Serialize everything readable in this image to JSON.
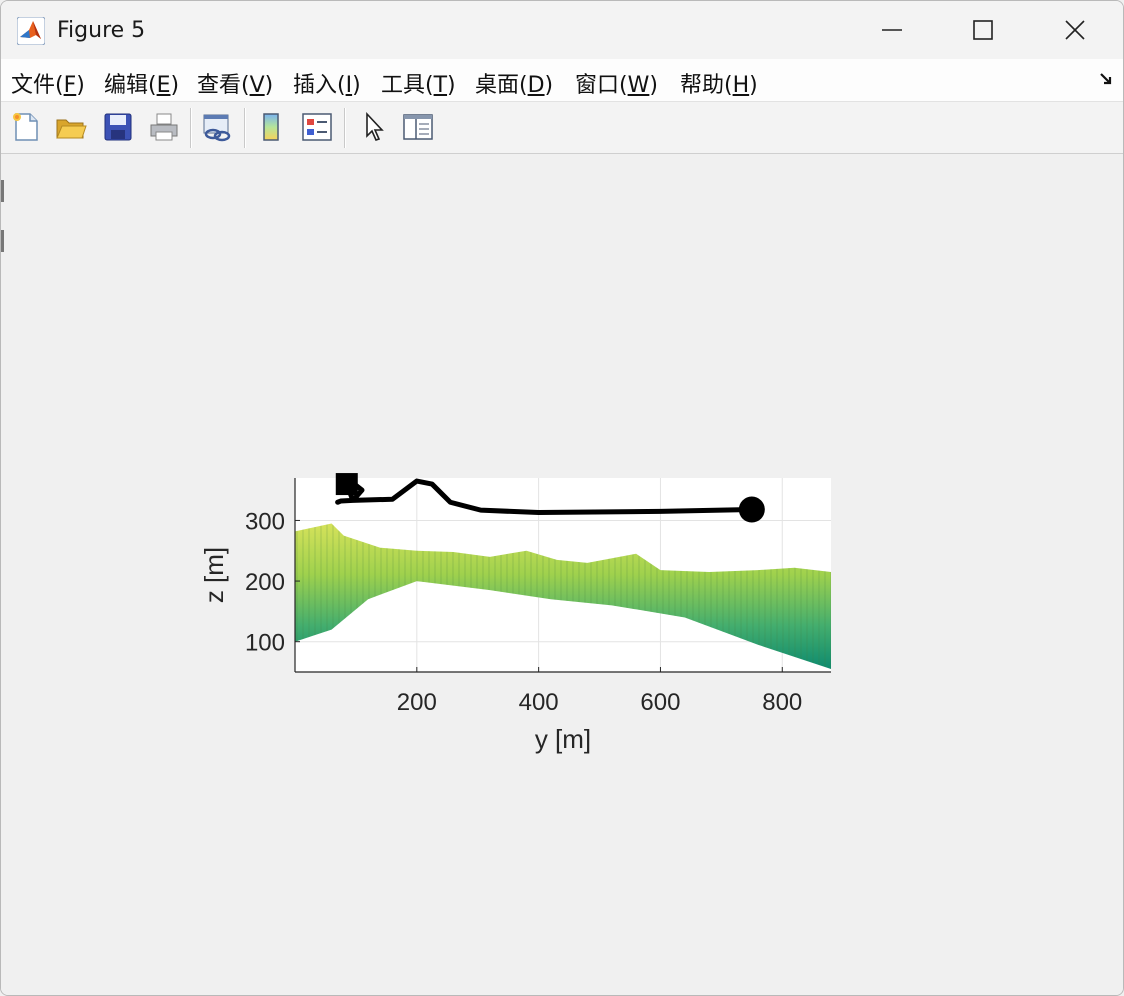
{
  "window": {
    "title": "Figure 5"
  },
  "window_controls": [
    "minimize",
    "maximize",
    "close"
  ],
  "menu": [
    {
      "text": "文件(",
      "key": "F",
      "close": ")"
    },
    {
      "text": "编辑(",
      "key": "E",
      "close": ")"
    },
    {
      "text": "查看(",
      "key": "V",
      "close": ")"
    },
    {
      "text": "插入(",
      "key": "I",
      "close": ")"
    },
    {
      "text": "工具(",
      "key": "T",
      "close": ")"
    },
    {
      "text": "桌面(",
      "key": "D",
      "close": ")"
    },
    {
      "text": "窗口(",
      "key": "W",
      "close": ")"
    },
    {
      "text": "帮助(",
      "key": "H",
      "close": ")"
    }
  ],
  "toolbar_icons": [
    "new-figure-icon",
    "open-file-icon",
    "save-icon",
    "print-icon",
    "link-icon",
    "colorbar-icon",
    "legend-icon",
    "pointer-icon",
    "property-inspector-icon"
  ],
  "chart_data": {
    "type": "line",
    "title": "",
    "xlabel": "y [m]",
    "ylabel": "z [m]",
    "xlim": [
      0,
      880
    ],
    "ylim": [
      50,
      370
    ],
    "xticks": [
      200,
      400,
      600,
      800
    ],
    "yticks": [
      100,
      200,
      300
    ],
    "grid": true,
    "series": [
      {
        "x": [
          70,
          75,
          95,
          110,
          100,
          85,
          95,
          160,
          200,
          225,
          255,
          305,
          400,
          600,
          750
        ],
        "y": [
          330,
          332,
          333,
          350,
          358,
          360,
          333,
          335,
          365,
          360,
          330,
          317,
          313,
          315,
          318
        ],
        "color": "#000000",
        "start_marker": "square",
        "end_marker": "circle"
      }
    ],
    "surface": {
      "top_y": [
        [
          "0",
          "282"
        ],
        [
          "60",
          "295"
        ],
        [
          "80",
          "275"
        ],
        [
          "140",
          "255"
        ],
        [
          "200",
          "250"
        ],
        [
          "260",
          "248"
        ],
        [
          "320",
          "240"
        ],
        [
          "380",
          "250"
        ],
        [
          "430",
          "235"
        ],
        [
          "480",
          "230"
        ],
        [
          "560",
          "245"
        ],
        [
          "600",
          "218"
        ],
        [
          "680",
          "215"
        ],
        [
          "760",
          "218"
        ],
        [
          "820",
          "222"
        ],
        [
          "880",
          "215"
        ]
      ],
      "colors": [
        "#d2e05a",
        "#9ccf4c",
        "#3fae6f",
        "#118e70"
      ]
    }
  }
}
